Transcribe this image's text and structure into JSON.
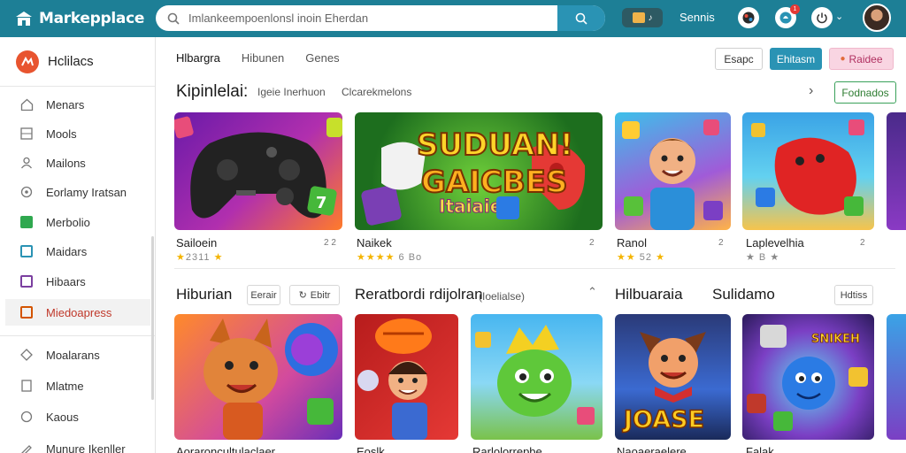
{
  "topbar": {
    "brand": "Markepplace",
    "search_value": "Imlankeempoenlonsl inoin Eherdan",
    "account_text": "Sennis",
    "notification_count": "1"
  },
  "sidebar": {
    "title": "Hclilacs",
    "items": [
      {
        "label": "Menars",
        "icon": "home-outline-icon"
      },
      {
        "label": "Mools",
        "icon": "grid-icon"
      },
      {
        "label": "Mailons",
        "icon": "user-icon"
      },
      {
        "label": "Eorlamy Iratsan",
        "icon": "settings-icon"
      },
      {
        "label": "Merbolio",
        "icon": "green-square-icon"
      },
      {
        "label": "Maidars",
        "icon": "blue-square-icon"
      },
      {
        "label": "Hibaars",
        "icon": "purple-square-icon"
      },
      {
        "label": "Miedoapress",
        "icon": "orange-square-icon"
      },
      {
        "label": "Moalarans",
        "icon": "diamond-icon"
      },
      {
        "label": "Mlatme",
        "icon": "file-icon"
      },
      {
        "label": "Kaous",
        "icon": "user-outline-icon"
      },
      {
        "label": "Munure Ikenller",
        "icon": "pencil-icon"
      }
    ]
  },
  "main": {
    "tabs": [
      "Hlbargra",
      "Hibunen",
      "Genes"
    ],
    "buttons": {
      "secondary": "Esapc",
      "primary": "Ehitasm",
      "pink": "Raidee"
    },
    "section1": {
      "title": "Kipinlelai:",
      "chips": [
        "Igeie Inerhuon",
        "Clcarekmelons"
      ],
      "action": "Fodnados"
    },
    "row1": [
      {
        "title": "Sailoein",
        "meta": "2 2",
        "stars_text": "2311"
      },
      {
        "title": "Naikek",
        "meta": "2",
        "stars_text": "6 Bo"
      },
      {
        "title": "Ranol",
        "meta": "2",
        "stars_text": "52"
      },
      {
        "title": "Laplevelhia",
        "meta": "2",
        "stars_text": "B"
      }
    ],
    "section2": {
      "title_a": "Hiburian",
      "btn_a": "Eerair",
      "btn_b": "Ebitr",
      "title_b": "Reratbordi rdijolran",
      "subtitle_b": "(Ioelialse)",
      "title_c": "Hilbuaraia",
      "title_d": "Sulidamo",
      "btn_c": "Hdtiss"
    },
    "row2": [
      {
        "title": "Aoraroncultulaclaer"
      },
      {
        "title": "Eoslk"
      },
      {
        "title": "Rarlolorrepbe"
      },
      {
        "title": "Naoaeraelere"
      },
      {
        "title": "Falak"
      }
    ],
    "art": {
      "featured_line1": "SUDUAN!",
      "featured_line2": "GAICBES",
      "featured_line3": "Itaiaie",
      "card_label": "JOASE",
      "card_label2": "SNIKEH"
    }
  }
}
